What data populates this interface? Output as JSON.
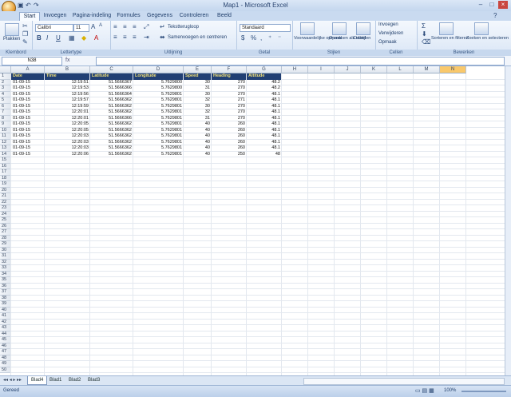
{
  "window": {
    "title": "Map1 - Microsoft Excel"
  },
  "tabs": [
    "Start",
    "Invoegen",
    "Pagina-indeling",
    "Formules",
    "Gegevens",
    "Controleren",
    "Beeld"
  ],
  "ribbon": {
    "paste_label": "Plakken",
    "font_name": "Calibri",
    "font_size": "11",
    "wrap_text": "Tekstterugloop",
    "merge_label": "Samenvoegen en centreren",
    "number_format": "Standaard",
    "conditional_format": "Voorwaardelijke opmaak",
    "format_as_table": "Opmaken als tabel",
    "cell_styles": "Celstijlen",
    "insert": "Invoegen",
    "delete": "Verwijderen",
    "format": "Opmaak",
    "sort_filter": "Sorteren en filteren",
    "find_select": "Zoeken en selecteren",
    "groups": {
      "clipboard": "Klembord",
      "font": "Lettertype",
      "alignment": "Uitlijning",
      "number": "Getal",
      "styles": "Stijlen",
      "cells": "Cellen",
      "editing": "Bewerken"
    }
  },
  "formula_bar": {
    "name_box": "N38",
    "fx": "fx",
    "formula": ""
  },
  "columns": [
    "A",
    "B",
    "C",
    "D",
    "E",
    "F",
    "G",
    "H",
    "I",
    "J",
    "K",
    "L",
    "M",
    "N"
  ],
  "selected_column": "N",
  "table": {
    "headers": [
      "Date",
      "Time",
      "Latitude",
      "Longitude",
      "Speed",
      "Heading",
      "Altitude"
    ],
    "rows": [
      [
        "01-09-15",
        "12:19:51",
        "51.5666367",
        "5.7629800",
        "30",
        "270",
        "48.2"
      ],
      [
        "01-09-15",
        "12:19:53",
        "51.5666366",
        "5.7629800",
        "31",
        "270",
        "48.2"
      ],
      [
        "01-09-15",
        "12:19:56",
        "51.5666364",
        "5.7629801",
        "30",
        "270",
        "48.1"
      ],
      [
        "01-09-15",
        "12:19:57",
        "51.5666362",
        "5.7629801",
        "32",
        "271",
        "48.1"
      ],
      [
        "01-09-15",
        "12:19:59",
        "51.5666362",
        "5.7629801",
        "30",
        "270",
        "48.1"
      ],
      [
        "01-09-15",
        "12:20:01",
        "51.5666362",
        "5.7629801",
        "32",
        "270",
        "48.1"
      ],
      [
        "01-09-15",
        "12:20:01",
        "51.5666366",
        "5.7629801",
        "31",
        "270",
        "48.1"
      ],
      [
        "01-09-15",
        "12:20:05",
        "51.5666362",
        "5.7629801",
        "40",
        "260",
        "48.1"
      ],
      [
        "01-09-15",
        "12:20:05",
        "51.5666362",
        "5.7629801",
        "40",
        "260",
        "48.1"
      ],
      [
        "01-09-15",
        "12:20:03",
        "51.5666362",
        "5.7629801",
        "40",
        "260",
        "48.1"
      ],
      [
        "01-09-15",
        "12:20:03",
        "51.5666362",
        "5.7629801",
        "40",
        "260",
        "48.1"
      ],
      [
        "01-09-15",
        "12:20:03",
        "51.5666362",
        "5.7629801",
        "40",
        "260",
        "48.1"
      ],
      [
        "01-09-15",
        "12:20:06",
        "51.5666362",
        "5.7629801",
        "40",
        "250",
        "48"
      ]
    ],
    "visible_row_count": 50
  },
  "sheets": [
    "Blad4",
    "Blad1",
    "Blad2",
    "Blad3"
  ],
  "status": {
    "ready": "Gereed",
    "zoom": "100%"
  },
  "colors": {
    "header_bg": "#213f73",
    "header_text": "#f3e27a",
    "accent": "#f9c86b"
  }
}
